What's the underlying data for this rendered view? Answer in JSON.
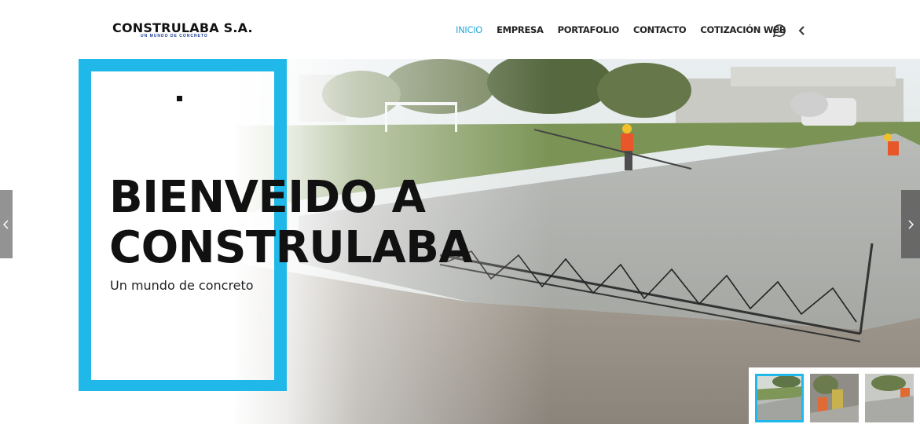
{
  "brand": {
    "name": "CONSTRULABA S.A.",
    "tagline": "UN MUNDO DE CONCRETO"
  },
  "nav": {
    "items": [
      {
        "label": "INICIO",
        "active": true
      },
      {
        "label": "EMPRESA",
        "active": false
      },
      {
        "label": "PORTAFOLIO",
        "active": false
      },
      {
        "label": "CONTACTO",
        "active": false
      },
      {
        "label": "COTIZACIÓN WEB",
        "active": false
      }
    ],
    "icons": [
      "whatsapp-icon",
      "chevron-left-icon"
    ]
  },
  "hero": {
    "title_line1": "BIENVEIDO A",
    "title_line2": "CONSTRULABA",
    "subtitle": "Un mundo de concreto"
  },
  "slider": {
    "thumbnail_count": 3,
    "active_index": 0
  },
  "colors": {
    "accent": "#1fb8e9",
    "nav_active": "#29a8d8",
    "text_dark": "#111111"
  }
}
